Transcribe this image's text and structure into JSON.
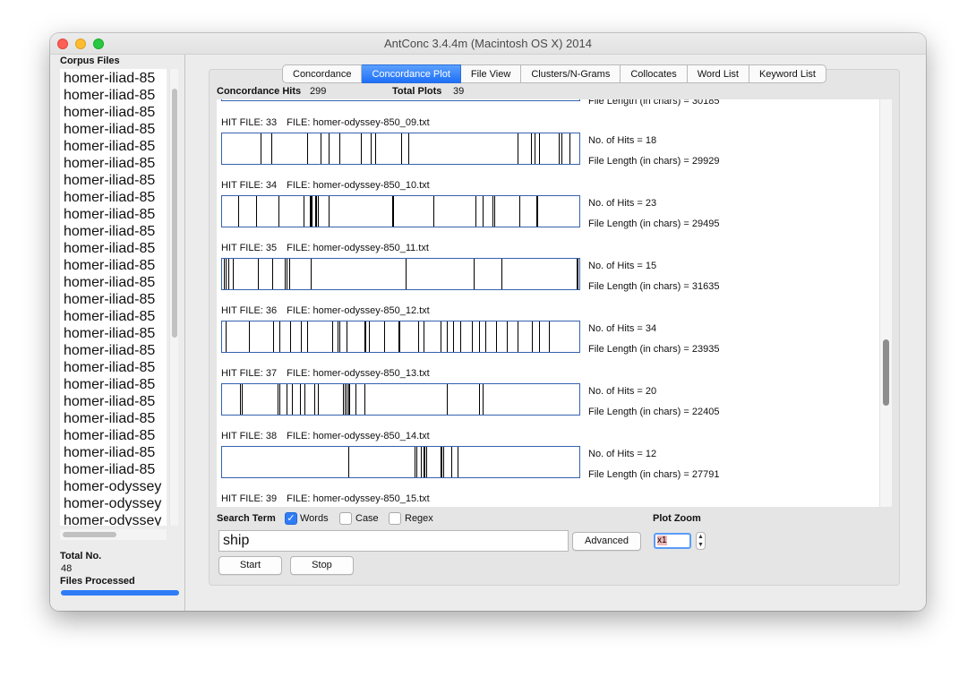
{
  "window": {
    "title": "AntConc 3.4.4m (Macintosh OS X) 2014"
  },
  "left_panel": {
    "heading": "Corpus Files",
    "files": [
      "homer-iliad-85",
      "homer-iliad-85",
      "homer-iliad-85",
      "homer-iliad-85",
      "homer-iliad-85",
      "homer-iliad-85",
      "homer-iliad-85",
      "homer-iliad-85",
      "homer-iliad-85",
      "homer-iliad-85",
      "homer-iliad-85",
      "homer-iliad-85",
      "homer-iliad-85",
      "homer-iliad-85",
      "homer-iliad-85",
      "homer-iliad-85",
      "homer-iliad-85",
      "homer-iliad-85",
      "homer-iliad-85",
      "homer-iliad-85",
      "homer-iliad-85",
      "homer-iliad-85",
      "homer-iliad-85",
      "homer-iliad-85",
      "homer-odyssey",
      "homer-odyssey",
      "homer-odyssey"
    ],
    "total_label": "Total No.",
    "total_value": "48",
    "processed_label": "Files Processed",
    "progress_fraction": 1.0
  },
  "tabs": [
    {
      "label": "Concordance",
      "active": false
    },
    {
      "label": "Concordance Plot",
      "active": true
    },
    {
      "label": "File View",
      "active": false
    },
    {
      "label": "Clusters/N-Grams",
      "active": false
    },
    {
      "label": "Collocates",
      "active": false
    },
    {
      "label": "Word List",
      "active": false
    },
    {
      "label": "Keyword List",
      "active": false
    }
  ],
  "hits_bar": {
    "hits_label": "Concordance Hits",
    "hits_value": "299",
    "plots_label": "Total Plots",
    "plots_value": "39"
  },
  "partial_plot": {
    "info": "File Length (in chars) = 30185"
  },
  "plots": [
    {
      "hit_file": "HIT FILE: 33",
      "file": "FILE: homer-odyssey-850_09.txt",
      "hits": "No. of Hits = 18",
      "length": "File Length (in chars) = 29929",
      "positions": [
        0.108,
        0.138,
        0.238,
        0.277,
        0.298,
        0.328,
        0.39,
        0.418,
        0.43,
        0.502,
        0.523,
        0.83,
        0.868,
        0.878,
        0.89,
        0.945,
        0.953,
        0.975
      ]
    },
    {
      "hit_file": "HIT FILE: 34",
      "file": "FILE: homer-odyssey-850_10.txt",
      "hits": "No. of Hits = 23",
      "length": "File Length (in chars) = 29495",
      "positions": [
        0.045,
        0.095,
        0.158,
        0.228,
        0.245,
        0.248,
        0.25,
        0.262,
        0.265,
        0.268,
        0.298,
        0.3,
        0.478,
        0.48,
        0.593,
        0.71,
        0.712,
        0.73,
        0.76,
        0.765,
        0.835,
        0.882,
        0.885
      ]
    },
    {
      "hit_file": "HIT FILE: 35",
      "file": "FILE: homer-odyssey-850_11.txt",
      "hits": "No. of Hits = 15",
      "length": "File Length (in chars) = 31635",
      "positions": [
        0.005,
        0.01,
        0.018,
        0.03,
        0.1,
        0.14,
        0.176,
        0.18,
        0.188,
        0.248,
        0.515,
        0.705,
        0.783,
        0.995,
        0.998
      ]
    },
    {
      "hit_file": "HIT FILE: 36",
      "file": "FILE: homer-odyssey-850_12.txt",
      "hits": "No. of Hits = 34",
      "length": "File Length (in chars) = 23935",
      "positions": [
        0.01,
        0.075,
        0.142,
        0.16,
        0.192,
        0.222,
        0.238,
        0.308,
        0.31,
        0.325,
        0.328,
        0.35,
        0.4,
        0.402,
        0.412,
        0.455,
        0.495,
        0.498,
        0.55,
        0.565,
        0.612,
        0.63,
        0.648,
        0.668,
        0.7,
        0.7,
        0.722,
        0.738,
        0.77,
        0.8,
        0.83,
        0.87,
        0.89,
        0.918
      ]
    },
    {
      "hit_file": "HIT FILE: 37",
      "file": "FILE: homer-odyssey-850_13.txt",
      "hits": "No. of Hits = 20",
      "length": "File Length (in chars) = 22405",
      "positions": [
        0.05,
        0.055,
        0.155,
        0.16,
        0.182,
        0.195,
        0.218,
        0.232,
        0.26,
        0.27,
        0.34,
        0.345,
        0.348,
        0.355,
        0.358,
        0.375,
        0.4,
        0.63,
        0.72,
        0.73
      ]
    },
    {
      "hit_file": "HIT FILE: 38",
      "file": "FILE: homer-odyssey-850_14.txt",
      "hits": "No. of Hits = 12",
      "length": "File Length (in chars) = 27791",
      "positions": [
        0.355,
        0.54,
        0.545,
        0.558,
        0.565,
        0.568,
        0.572,
        0.612,
        0.615,
        0.62,
        0.642,
        0.66
      ]
    },
    {
      "hit_file": "HIT FILE: 39",
      "file": "FILE: homer-odyssey-850_15.txt"
    }
  ],
  "search": {
    "label": "Search Term",
    "words_label": "Words",
    "words_checked": true,
    "case_label": "Case",
    "case_checked": false,
    "regex_label": "Regex",
    "regex_checked": false,
    "value": "ship",
    "advanced_label": "Advanced",
    "start_label": "Start",
    "stop_label": "Stop",
    "zoom_label": "Plot Zoom",
    "zoom_value": "x1"
  },
  "colors": {
    "accent": "#2f7df6",
    "plot_border": "#3461b0"
  }
}
